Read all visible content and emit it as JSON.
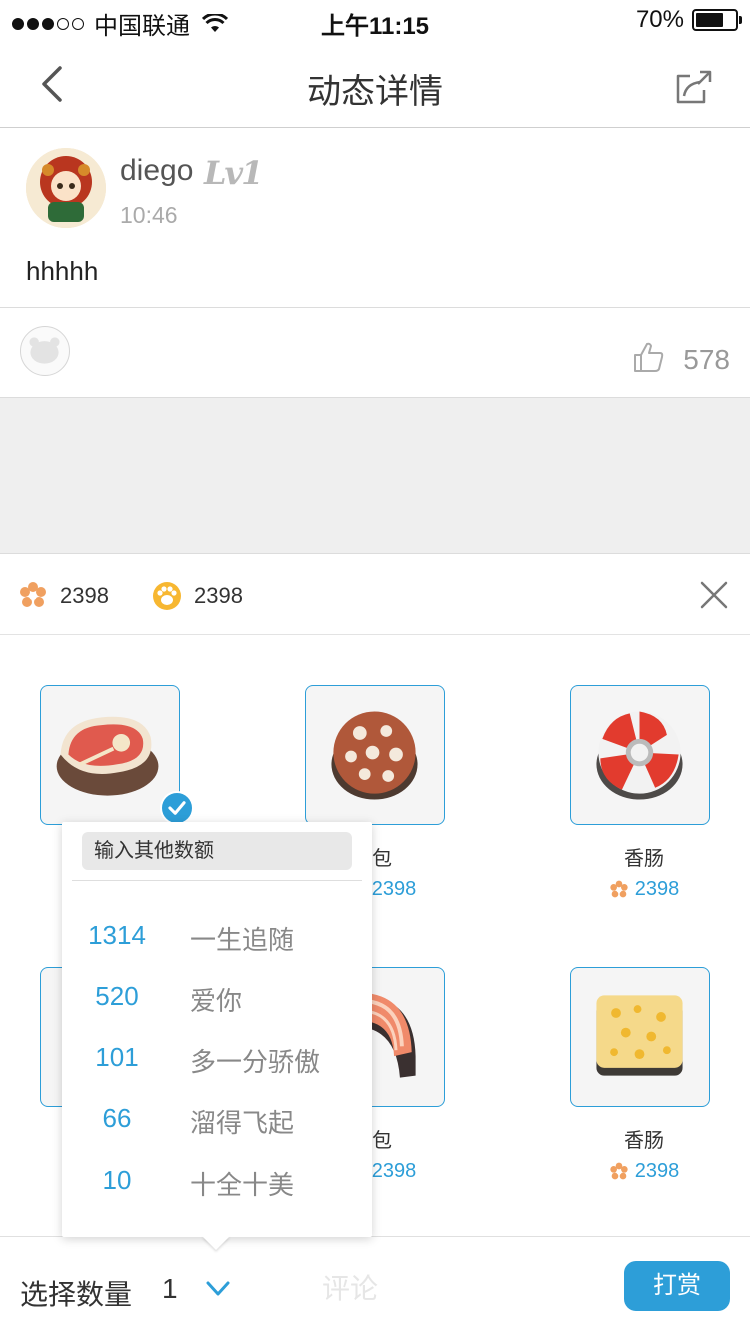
{
  "status_bar": {
    "carrier": "中国联通",
    "time": "上午11:15",
    "battery": "70%",
    "battery_level": 0.7,
    "signal_bars": 3
  },
  "nav": {
    "title": "动态详情",
    "back_icon": "chevron-left-icon",
    "share_icon": "share-icon"
  },
  "post": {
    "username": "diego",
    "level_badge": "Lv1",
    "time": "10:46",
    "content": "hhhhh"
  },
  "likes": {
    "count": "578"
  },
  "balance": {
    "flower_coins": "2398",
    "paw_coins": "2398"
  },
  "gifts": [
    {
      "name": "",
      "price": "",
      "icon": "steak-icon",
      "selected": true
    },
    {
      "name": "包",
      "price": "2398",
      "icon": "sausage-slice-icon",
      "selected": false
    },
    {
      "name": "香肠",
      "price": "2398",
      "icon": "candy-icon",
      "selected": false
    },
    {
      "name": "",
      "price": "",
      "icon": "gift-icon",
      "selected": false
    },
    {
      "name": "包",
      "price": "2398",
      "icon": "salmon-icon",
      "selected": false
    },
    {
      "name": "香肠",
      "price": "2398",
      "icon": "cheese-icon",
      "selected": false
    }
  ],
  "quantity_popover": {
    "custom_placeholder": "输入其他数额",
    "options": [
      {
        "amount": "1314",
        "label": "一生追随"
      },
      {
        "amount": "520",
        "label": "爱你"
      },
      {
        "amount": "101",
        "label": "多一分骄傲"
      },
      {
        "amount": "66",
        "label": "溜得飞起"
      },
      {
        "amount": "10",
        "label": "十全十美"
      }
    ]
  },
  "bottom_bar": {
    "quantity_label": "选择数量",
    "quantity_value": "1",
    "tip_button": "打赏",
    "ghost_text": "评论"
  },
  "colors": {
    "accent": "#2d9ed8",
    "divider": "#dcdcdc",
    "gray_bg": "#efefef"
  }
}
